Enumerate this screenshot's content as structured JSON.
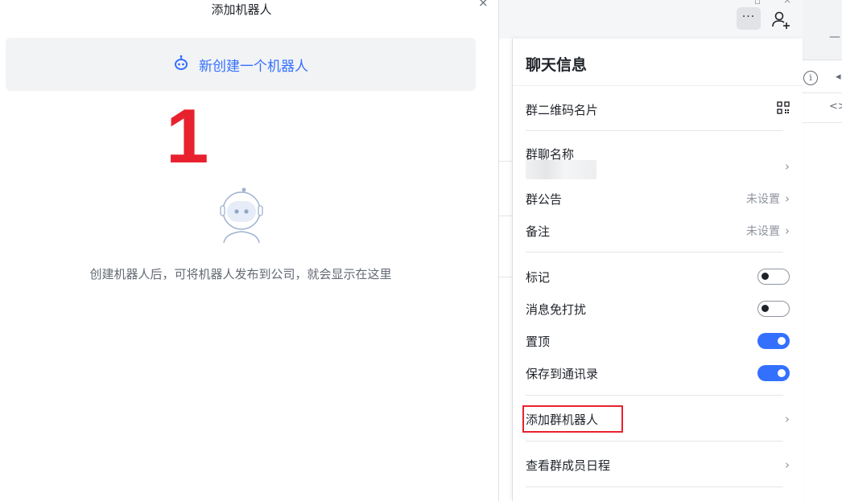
{
  "dialog": {
    "title": "添加机器人",
    "close": "×",
    "create_button": "新创建一个机器人",
    "step_marker": "1",
    "empty_text": "创建机器人后，可将机器人发布到公司，就会显示在这里"
  },
  "toolbar": {
    "more_label": "···",
    "add_member_icon": "add-user-icon"
  },
  "background_window": {
    "dash": "—",
    "info": "i",
    "arrow": "◂",
    "code": "<>"
  },
  "panel": {
    "title": "聊天信息",
    "rows": [
      {
        "label": "群二维码名片",
        "right_icon": "qrcode-icon"
      },
      {
        "label": "群聊名称",
        "value": ""
      },
      {
        "label": "群公告",
        "value": "未设置"
      },
      {
        "label": "备注",
        "value": "未设置"
      },
      {
        "label": "标记",
        "toggle": "off"
      },
      {
        "label": "消息免打扰",
        "toggle": "off"
      },
      {
        "label": "置顶",
        "toggle": "on"
      },
      {
        "label": "保存到通讯录",
        "toggle": "on"
      },
      {
        "label": "添加群机器人",
        "highlighted": true
      },
      {
        "label": "查看群成员日程"
      }
    ],
    "chevron": "›"
  },
  "colors": {
    "accent": "#3370ff",
    "marker_red": "#e8212e",
    "text_primary": "#1f2329",
    "text_secondary": "#8f959e"
  }
}
